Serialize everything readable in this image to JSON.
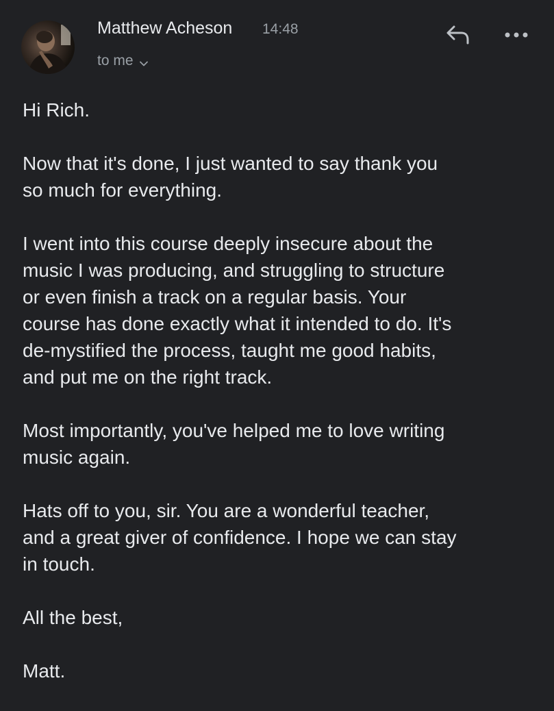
{
  "sender": {
    "name": "Matthew Acheson",
    "time": "14:48",
    "recipient_label": "to me"
  },
  "icons": {
    "avatar": "sender-avatar",
    "reply": "reply-arrow-icon",
    "more": "more-horizontal-icon",
    "expand": "chevron-down-icon"
  },
  "colors": {
    "background": "#202124",
    "text": "#e8eaed",
    "muted": "#9aa0a6"
  },
  "message": {
    "paragraphs": [
      "Hi Rich.",
      "Now that it's done, I just wanted to say thank you\nso much for everything.",
      "I went into this course deeply insecure about the\nmusic I was producing, and struggling to structure\nor even finish a track on a regular basis. Your\ncourse has done exactly what it intended to do. It's\nde-mystified the process, taught me good habits,\nand put me on the right track.",
      "Most importantly, you've helped me to love writing\nmusic again.",
      "Hats off to you, sir. You are a wonderful teacher,\nand a great giver of confidence. I hope we can stay\nin touch.",
      "All the best,",
      "Matt."
    ]
  }
}
